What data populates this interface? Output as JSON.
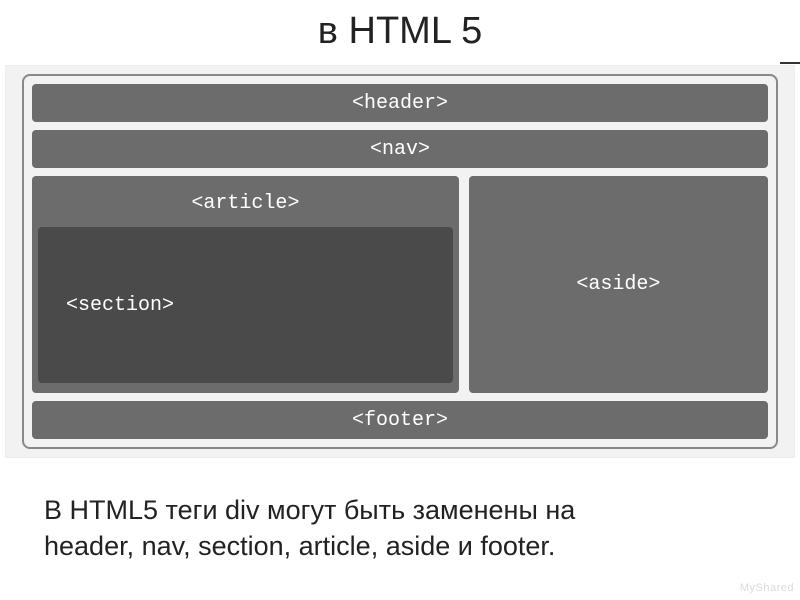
{
  "title": "в HTML 5",
  "layout": {
    "header": "<header>",
    "nav": "<nav>",
    "article": "<article>",
    "section": "<section>",
    "aside": "<aside>",
    "footer": "<footer>"
  },
  "caption_line1": "В HTML5 теги div могут быть заменены на",
  "caption_line2": "header, nav, section, article, aside и footer.",
  "watermark": "MyShared"
}
